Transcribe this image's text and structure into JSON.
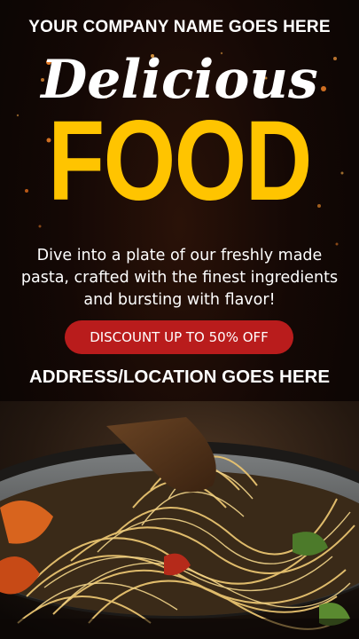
{
  "header": {
    "company_name": "YOUR COMPANY NAME GOES HERE"
  },
  "hero": {
    "title_script": "Delicious",
    "title_main": "FOOD",
    "description": "Dive into a plate of our freshly made pasta, crafted with the finest ingredients and bursting with flavor!"
  },
  "promo": {
    "discount_label": "DISCOUNT UP TO 50% OFF"
  },
  "footer": {
    "address": "ADDRESS/LOCATION GOES HERE"
  },
  "colors": {
    "accent_yellow": "#ffc400",
    "button_red": "#b91c1c",
    "text_white": "#ffffff",
    "background": "#0d0806"
  }
}
